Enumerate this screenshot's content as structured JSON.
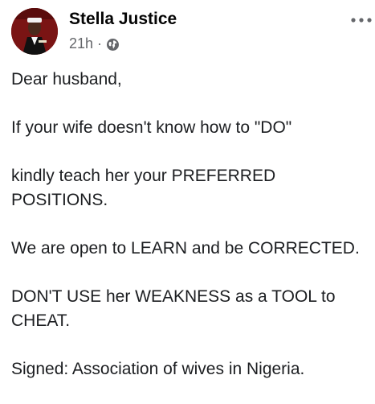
{
  "post": {
    "author": "Stella Justice",
    "time": "21h",
    "separator": "·",
    "privacy_icon": "globe-icon",
    "more_icon": "more-dots-icon",
    "paragraphs": [
      "Dear husband,",
      "If your wife doesn't know how to \"DO\"",
      "kindly teach her your PREFERRED POSITIONS.",
      "We are open to LEARN and be CORRECTED.",
      "DON'T USE her WEAKNESS as a TOOL to CHEAT.",
      "Signed: Association of wives in Nigeria."
    ]
  },
  "colors": {
    "text": "#1c1e21",
    "meta": "#65676b",
    "avatar_bg": "#7a1414"
  }
}
